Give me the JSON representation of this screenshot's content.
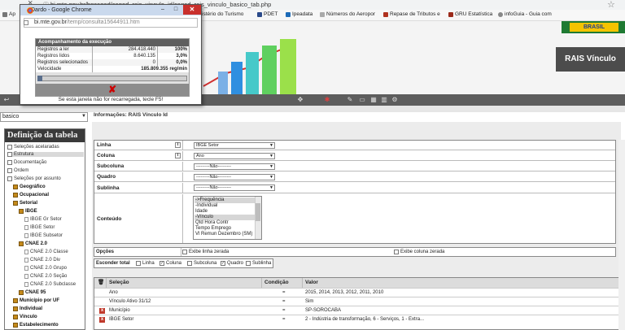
{
  "browser": {
    "url": "bi.mte.gov.br/bgcaged/caged_rais_vinculo_id/caged_rais_vinculo_basico_tab.php",
    "bookmarks": [
      {
        "label": "Ap"
      },
      {
        "label": "inistério do Turismo"
      },
      {
        "label": "PDET"
      },
      {
        "label": "Ipeadata"
      },
      {
        "label": "Números do Aeropor"
      },
      {
        "label": "Repase de Tributos e"
      },
      {
        "label": "GRU Estatística"
      },
      {
        "label": "infoGuia - Guia com"
      }
    ]
  },
  "header": {
    "brasil": "BRASIL",
    "title": "RAIS Vínculo"
  },
  "popup": {
    "title": "Dardo - Google Chrome",
    "url_prefix": "bi.mte.gov.br",
    "url_suffix": "/temp/consulta15644911.htm",
    "heading": "Acompanhamento da execução",
    "rows": [
      {
        "label": "Registros a ler",
        "value": "284.418.440",
        "pct": "100%"
      },
      {
        "label": "Registros lidos",
        "value": "8.640.135",
        "pct": "3,0%"
      },
      {
        "label": "Registros selecionados",
        "value": "0",
        "pct": "0,0%"
      },
      {
        "label": "Velocidade",
        "value": "185.809.355 reg/min",
        "pct": ""
      }
    ],
    "progress": 0.03,
    "cancel": "✘",
    "note": "Se esta janela não for recarregada, tecle F5!"
  },
  "sidebar": {
    "dropdown": "basico",
    "title": "Definição da tabela",
    "items": [
      {
        "label": "Seleções acelaradas"
      },
      {
        "label": "Estrutura"
      },
      {
        "label": "Documentação"
      },
      {
        "label": "Ordem"
      },
      {
        "label": "Seleções por assunto"
      },
      {
        "label": "Geográfico"
      },
      {
        "label": "Ocupacional"
      },
      {
        "label": "Setorial"
      },
      {
        "label": "IBGE"
      },
      {
        "label": "IBGE Gr Setor"
      },
      {
        "label": "IBGE Setor"
      },
      {
        "label": "IBGE Subsetor"
      },
      {
        "label": "CNAE 2.0"
      },
      {
        "label": "CNAE 2.0 Classe"
      },
      {
        "label": "CNAE 2.0 Div"
      },
      {
        "label": "CNAE 2.0 Grupo"
      },
      {
        "label": "CNAE 2.0 Seção"
      },
      {
        "label": "CNAE 2.0 Subclasse"
      },
      {
        "label": "CNAE 95"
      },
      {
        "label": "Município por UF"
      },
      {
        "label": "Individual"
      },
      {
        "label": "Vínculo"
      },
      {
        "label": "Estabelecimento"
      }
    ]
  },
  "main": {
    "info": "Informações: RAIS Vínculo Id",
    "linha_label": "Linha",
    "linha_value": "IBGE Setor",
    "coluna_label": "Coluna",
    "coluna_value": "Ano",
    "subcoluna_label": "Subcoluna",
    "subcoluna_value": "---------Não---------",
    "quadro_label": "Quadro",
    "quadro_value": "---------Não---------",
    "sublinha_label": "Sublinha",
    "sublinha_value": "---------Não---------",
    "conteudo_label": "Conteúdo",
    "conteudo_options": [
      "->Frequência",
      "-Individual",
      "Idade",
      "-Vínculo",
      "Qtd Hora Contr",
      "Tempo Emprego",
      "Vl Remun Dezembro (SM)"
    ],
    "opcoes_label": "Opções",
    "opt_linha_zerada": "Exibe linha zerada",
    "opt_coluna_zerada": "Exibe coluna zerada",
    "esconder_label": "Esconder total",
    "hide_items": [
      {
        "label": "Linha",
        "checked": false
      },
      {
        "label": "Coluna",
        "checked": true
      },
      {
        "label": "Subcoluna",
        "checked": false
      },
      {
        "label": "Quadro",
        "checked": true
      },
      {
        "label": "Sublinha",
        "checked": false
      }
    ]
  },
  "selection": {
    "headers": {
      "selecao": "Seleção",
      "condicao": "Condição",
      "valor": "Valor"
    },
    "rows": [
      {
        "selecao": "Ano",
        "condicao": "=",
        "valor": "2015, 2014, 2013, 2012, 2011, 2010"
      },
      {
        "selecao": "Vínculo Ativo 31/12",
        "condicao": "=",
        "valor": "Sim"
      },
      {
        "selecao": "Município",
        "condicao": "=",
        "valor": "SP-SOROCABA"
      },
      {
        "selecao": "IBGE Setor",
        "condicao": "=",
        "valor": "2 - Indústria de transformação, 6 - Serviços, 1 - Extra..."
      }
    ]
  }
}
